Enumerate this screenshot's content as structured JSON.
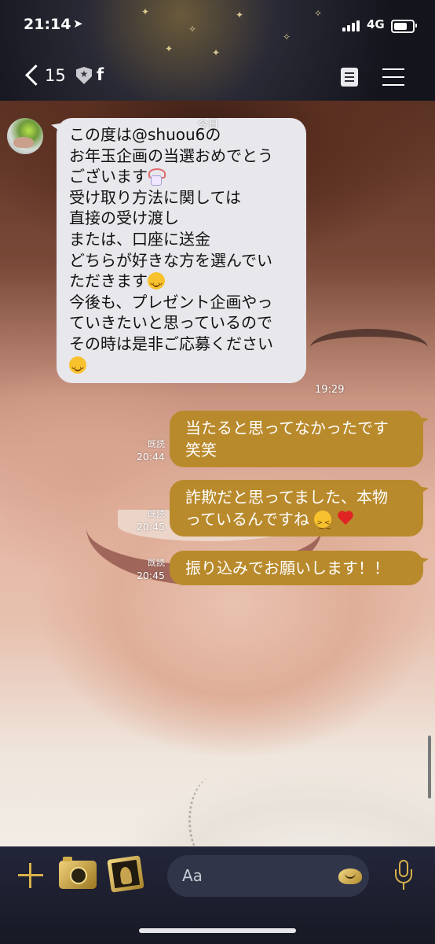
{
  "status_bar": {
    "time": "21:14",
    "location_icon": "location-arrow-icon",
    "network": "4G",
    "signal_bars": 4,
    "battery_level": 0.9
  },
  "nav": {
    "back_count": "15",
    "contact_name": "f",
    "icons": [
      "back-chevron-icon",
      "shield-star-icon",
      "note-icon",
      "menu-icon"
    ]
  },
  "chat": {
    "date_label": "今日",
    "incoming": {
      "lines": [
        "この度は@shuou6の",
        "お年玉企画の当選おめでとう",
        "ございます",
        "受け取り方法に関しては",
        "直接の受け渡し",
        "または、口座に送金",
        "どちらが好きな方を選んでい",
        "ただきます",
        "今後も、プレゼント企画やっ",
        "ていきたいと思っているので",
        "その時は是非ご応募ください",
        ""
      ],
      "time": "19:29"
    },
    "outgoing": [
      {
        "lines": [
          "当たると思ってなかったです",
          "笑笑"
        ],
        "read": "既読",
        "time": "20:44"
      },
      {
        "lines": [
          "詐欺だと思ってました、本物",
          "っているんですね"
        ],
        "read": "既読",
        "time": "20:45"
      },
      {
        "lines": [
          "振り込みでお願いします！！"
        ],
        "read": "既読",
        "time": "20:45"
      }
    ]
  },
  "input": {
    "placeholder": "Aa"
  },
  "colors": {
    "outgoing_bubble": "#b98a2c",
    "incoming_bubble": "#e7e7ec",
    "accent_gold": "#d8b14a"
  }
}
